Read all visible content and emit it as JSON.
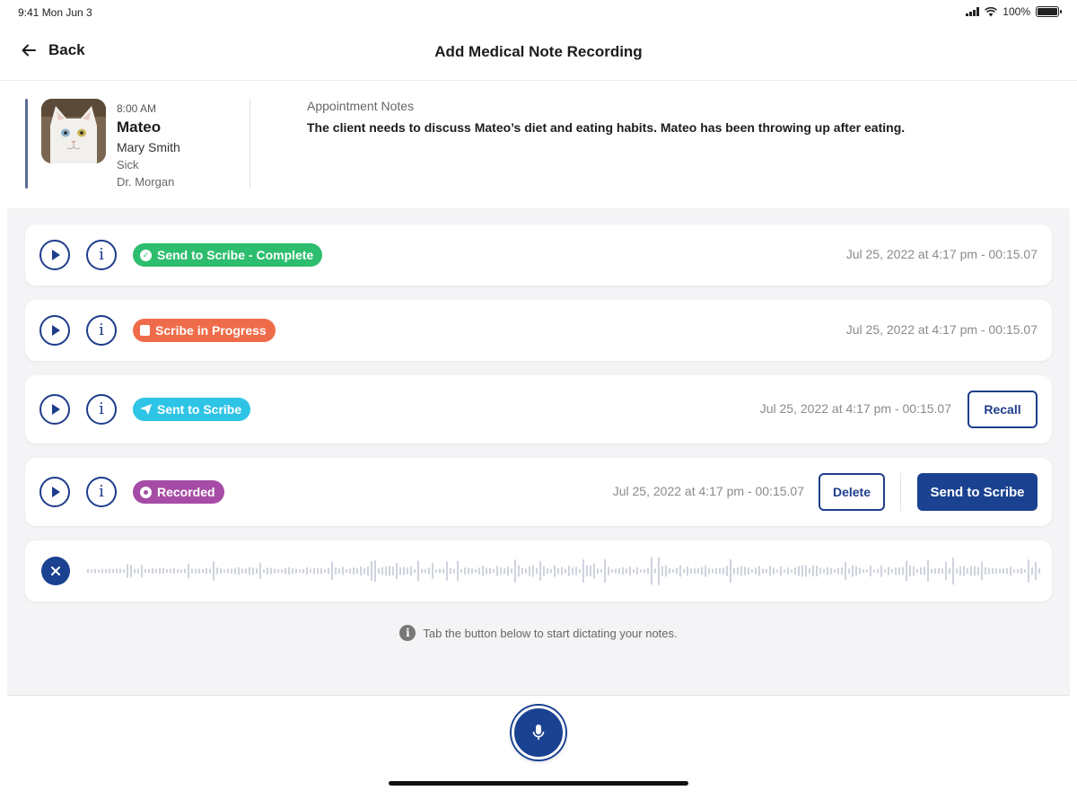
{
  "status_bar": {
    "time": "9:41  Mon Jun 3",
    "battery": "100%",
    "battery_level": 1.0
  },
  "nav": {
    "back_label": "Back",
    "title": "Add Medical Note Recording"
  },
  "patient": {
    "time": "8:00 AM",
    "name": "Mateo",
    "owner": "Mary Smith",
    "reason": "Sick",
    "doctor": "Dr. Morgan"
  },
  "notes": {
    "label": "Appointment Notes",
    "text": "The client needs to discuss Mateo’s diet and eating habits. Mateo has been throwing up after eating."
  },
  "recordings": [
    {
      "status": "Send to Scribe - Complete",
      "status_color": "#2dbd6e",
      "icon": "check-circle-icon",
      "timestamp": "Jul 25, 2022 at 4:17 pm - 00:15.07"
    },
    {
      "status": "Scribe in Progress",
      "status_color": "#ef6c4a",
      "icon": "document-icon",
      "timestamp": "Jul 25, 2022 at 4:17 pm - 00:15.07"
    },
    {
      "status": "Sent to Scribe",
      "status_color": "#2ec4e6",
      "icon": "send-icon",
      "timestamp": "Jul 25, 2022 at 4:17 pm - 00:15.07",
      "action": "Recall"
    },
    {
      "status": "Recorded",
      "status_color": "#a64ca6",
      "icon": "record-icon",
      "timestamp": "Jul 25, 2022 at 4:17 pm - 00:15.07",
      "delete_label": "Delete",
      "send_label": "Send to Scribe"
    }
  ],
  "hint": "Tab the button below to start dictating your notes.",
  "colors": {
    "primary": "#1b4291",
    "background": "#f4f4f6",
    "waveform": "#c3c8d6"
  }
}
